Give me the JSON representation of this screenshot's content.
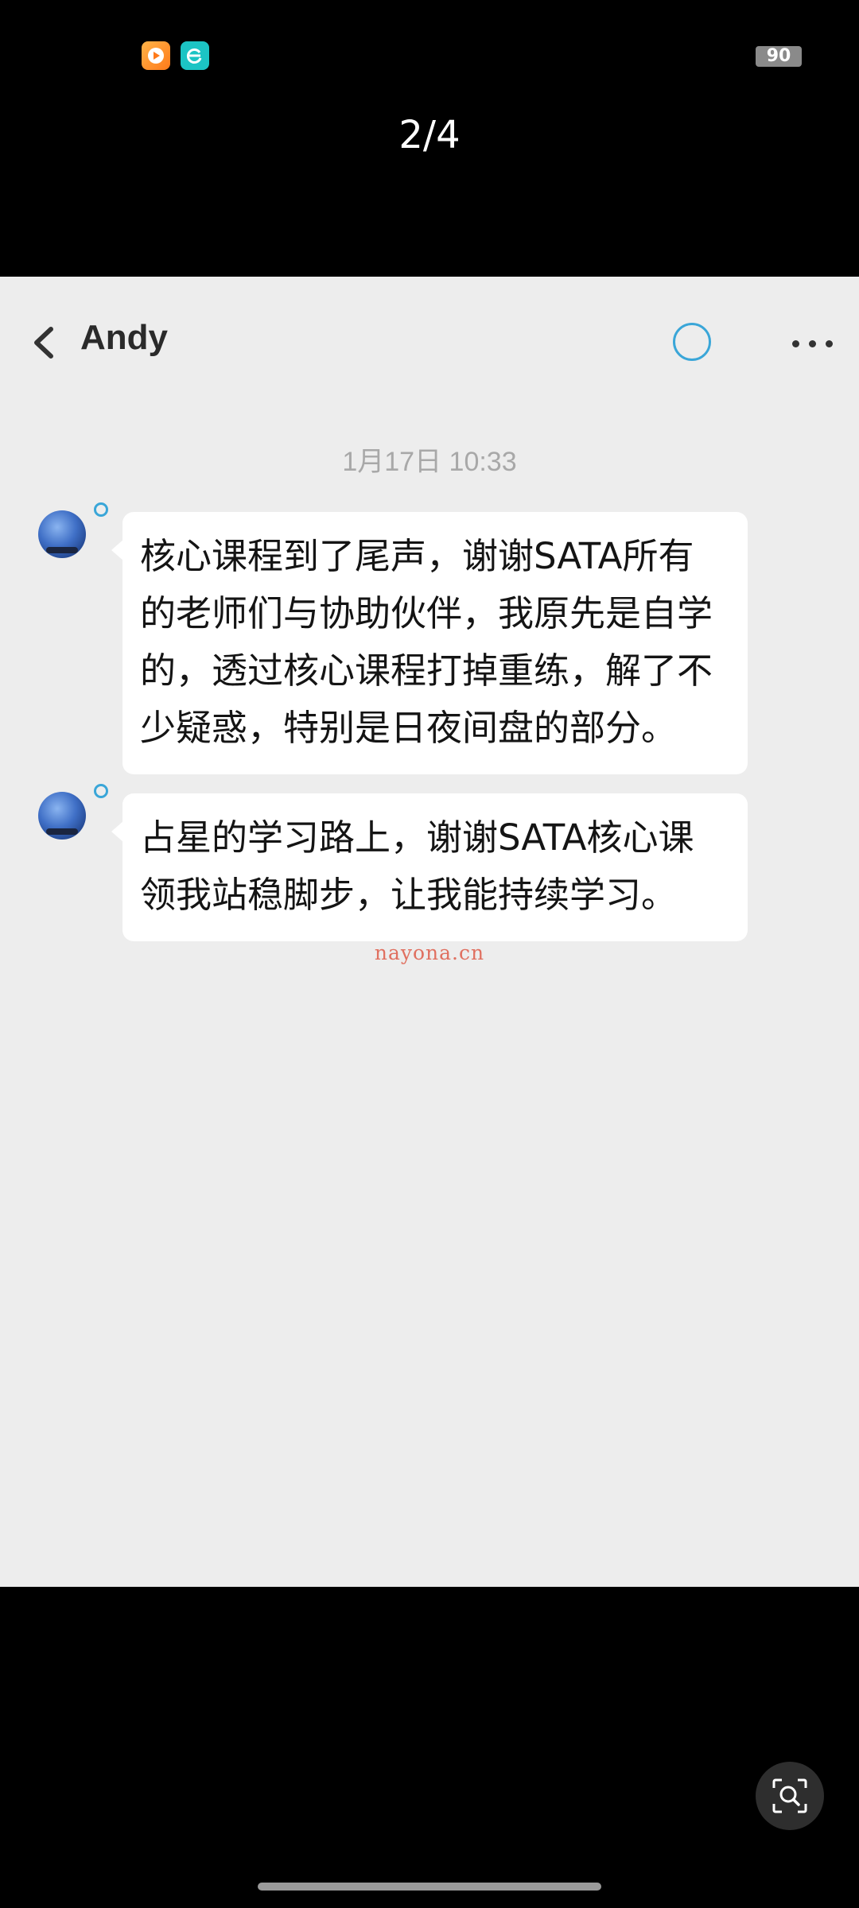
{
  "status_bar": {
    "apps": [
      "video-app-icon",
      "browser-app-icon"
    ],
    "battery": "90"
  },
  "viewer": {
    "page_indicator": "2/4"
  },
  "chat": {
    "contact_name": "Andy",
    "timestamp": "1月17日 10:33",
    "messages": [
      {
        "text": "核心课程到了尾声，谢谢SATA所有\n的老师们与协助伙伴，我原先是自学\n的，透过核心课程打掉重练，解了不\n少疑惑，特别是日夜间盘的部分。"
      },
      {
        "text": "占星的学习路上，谢谢SATA核心课\n领我站稳脚步，让我能持续学习。"
      }
    ],
    "watermark": "nayona.cn"
  },
  "colors": {
    "chat_background": "#ededed",
    "bubble": "#ffffff",
    "accent": "#3aa6d8",
    "watermark": "#e07060"
  }
}
